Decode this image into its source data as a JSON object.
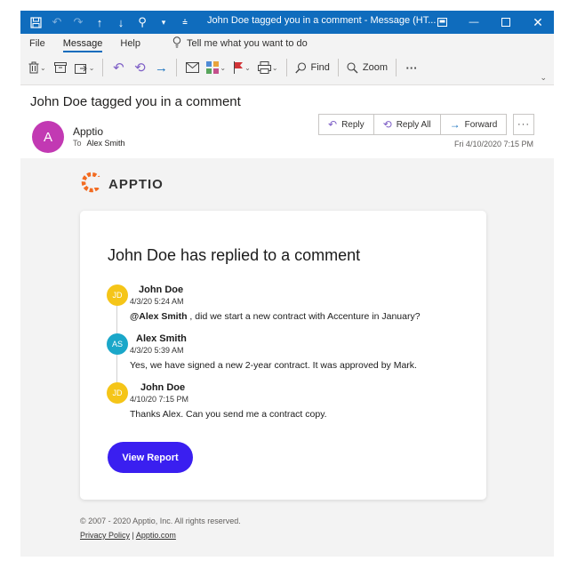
{
  "window": {
    "title": "John Doe tagged you in a comment  -  Message (HT...",
    "titlebar_color": "#0f6cbd"
  },
  "ribbon": {
    "tabs": [
      "File",
      "Message",
      "Help"
    ],
    "active_tab": "Message",
    "tell_me": "Tell me what you want to do",
    "find_label": "Find",
    "zoom_label": "Zoom",
    "more_label": "···"
  },
  "message": {
    "subject": "John Doe tagged you in a comment",
    "avatar_initial": "A",
    "avatar_color": "#c239b3",
    "sender": "Apptio",
    "to_label": "To",
    "to_name": "Alex Smith",
    "reply_label": "Reply",
    "reply_all_label": "Reply All",
    "forward_label": "Forward",
    "more_label": "···",
    "date": "Fri 4/10/2020 7:15 PM"
  },
  "email": {
    "logo_text": "APPTIO",
    "brand_color": "#f26b21",
    "heading": "John Doe has replied to a comment",
    "comments": [
      {
        "initials": "JD",
        "name": "John Doe",
        "time": "4/3/20 5:24 AM",
        "mention": "@Alex Smith",
        "text": " , did we start a new contract with Accenture in January?"
      },
      {
        "initials": "AS",
        "name": "Alex Smith",
        "time": "4/3/20 5:39 AM",
        "text": "Yes, we have signed a new 2-year contract. It was approved by Mark."
      },
      {
        "initials": "JD",
        "name": "John Doe",
        "time": "4/10/20 7:15 PM",
        "text": "Thanks Alex. Can you send me a contract copy."
      }
    ],
    "button_label": "View Report",
    "button_color": "#3a1ff0",
    "copyright": "© 2007 - 2020 Apptio, Inc. All rights reserved.",
    "privacy_label": "Privacy Policy",
    "separator": " | ",
    "site_label": "Apptio.com"
  }
}
